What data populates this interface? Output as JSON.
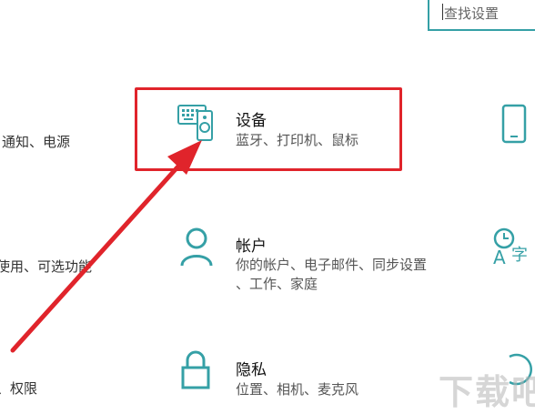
{
  "search": {
    "placeholder": "查找设置"
  },
  "left_fragments": {
    "row1": "通知、电源",
    "row2": "使用、可选功能",
    "row3": "、权限"
  },
  "tiles": {
    "devices": {
      "title": "设备",
      "desc": "蓝牙、打印机、鼠标",
      "icon": "keyboard-speaker-icon"
    },
    "accounts": {
      "title": "帐户",
      "desc_line1": "你的帐户、电子邮件、同步设置",
      "desc_line2": "、工作、家庭",
      "icon": "person-icon"
    },
    "privacy": {
      "title": "隐私",
      "desc": "位置、相机、麦克风",
      "icon": "lock-icon"
    }
  },
  "right_icons": [
    "phone-icon",
    "time-language-icon",
    "update-icon"
  ],
  "watermark": {
    "text": "下载吧"
  },
  "colors": {
    "accent": "#35a0a6",
    "highlight": "#e0242b"
  }
}
